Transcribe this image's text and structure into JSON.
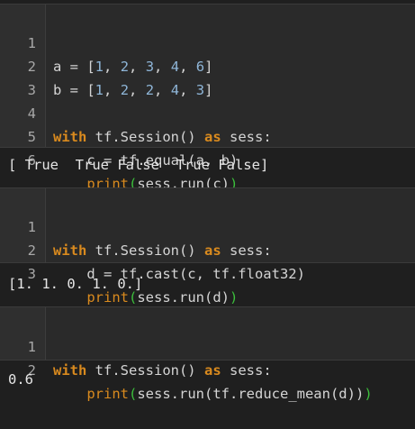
{
  "cells": [
    {
      "lines": [
        {
          "n": "1",
          "t": [
            "a = [",
            "1",
            ", ",
            "2",
            ", ",
            "3",
            ", ",
            "4",
            ", ",
            "6",
            "]"
          ]
        },
        {
          "n": "2",
          "t": [
            "b = [",
            "1",
            ", ",
            "2",
            ", ",
            "2",
            ", ",
            "4",
            ", ",
            "3",
            "]"
          ]
        },
        {
          "n": "3",
          "t": [
            ""
          ]
        },
        {
          "n": "4",
          "t": [
            "with",
            " tf.Session() ",
            "as",
            " sess:"
          ]
        },
        {
          "n": "5",
          "t": [
            "    c = tf.equal(a, b)"
          ]
        },
        {
          "n": "6",
          "t": [
            "    ",
            "print",
            "(",
            "sess.run(c)",
            ")"
          ]
        }
      ],
      "output": "[ True  True False  True False]"
    },
    {
      "lines": [
        {
          "n": "1",
          "t": [
            "with",
            " tf.Session() ",
            "as",
            " sess:"
          ]
        },
        {
          "n": "2",
          "t": [
            "    d = tf.cast(c, tf.float32)"
          ]
        },
        {
          "n": "3",
          "t": [
            "    ",
            "print",
            "(",
            "sess.run(d)",
            ")"
          ]
        }
      ],
      "output": "[1. 1. 0. 1. 0.]"
    },
    {
      "lines": [
        {
          "n": "1",
          "t": [
            "with",
            " tf.Session() ",
            "as",
            " sess:"
          ]
        },
        {
          "n": "2",
          "t": [
            "    ",
            "print",
            "(",
            "sess.run(tf.reduce_mean(d))",
            ")"
          ]
        }
      ],
      "output": "0.6"
    }
  ],
  "colors": {
    "background": "#1f1f1f",
    "cell_background": "#2a2a2a",
    "keyword": "#d98a1e",
    "number": "#8fb6d8",
    "paren": "#3cbf3c",
    "text": "#d4d4d4"
  }
}
